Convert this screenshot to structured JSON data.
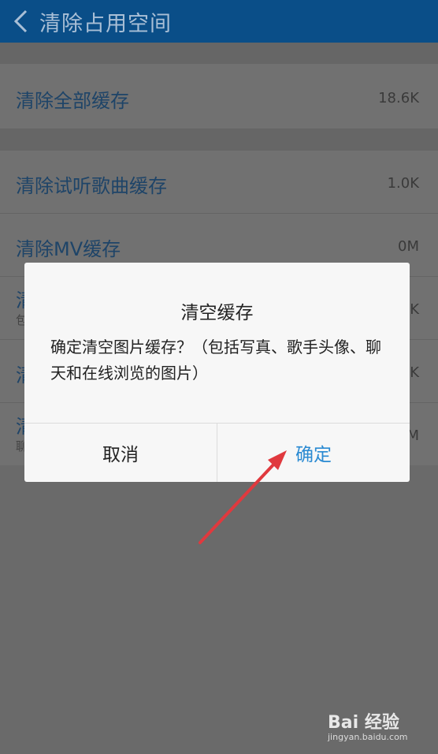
{
  "header": {
    "title": "清除占用空间"
  },
  "rows": [
    {
      "title": "清除全部缓存",
      "size": "18.6K"
    },
    {
      "title": "清除试听歌曲缓存",
      "size": "1.0K"
    },
    {
      "title": "清除MV缓存",
      "size": "0M"
    },
    {
      "title": "清",
      "subtitle": "包",
      "size": "K"
    },
    {
      "title": "清",
      "size": "K"
    },
    {
      "title": "清",
      "subtitle": "聊",
      "size": "M"
    }
  ],
  "dialog": {
    "title": "清空缓存",
    "message": "确定清空图片缓存？（包括写真、歌手头像、聊天和在线浏览的图片）",
    "cancel_label": "取消",
    "confirm_label": "确定"
  },
  "watermark": {
    "logo": "Bai 经验",
    "url": "jingyan.baidu.com"
  },
  "colors": {
    "header": "#0a4e88",
    "confirm": "#2a8ad2",
    "arrow": "#e0393e"
  }
}
